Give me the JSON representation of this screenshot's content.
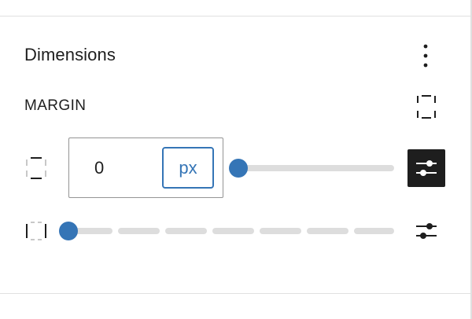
{
  "panel": {
    "title": "Dimensions",
    "options_icon": "more-vertical-icon"
  },
  "margin": {
    "label": "MARGIN",
    "link_sides_icon": "link-sides-icon",
    "side_icon": "side-top-bottom-icon",
    "value": "0",
    "unit": "px",
    "slider_value": 0,
    "custom_icon": "settings-sliders-icon",
    "preset_side_icon": "side-left-right-icon",
    "preset_steps": 7,
    "preset_value": 0
  },
  "colors": {
    "accent": "#3575b6",
    "dark": "#1e1e1e",
    "track": "#dddddd",
    "border": "#949494"
  }
}
